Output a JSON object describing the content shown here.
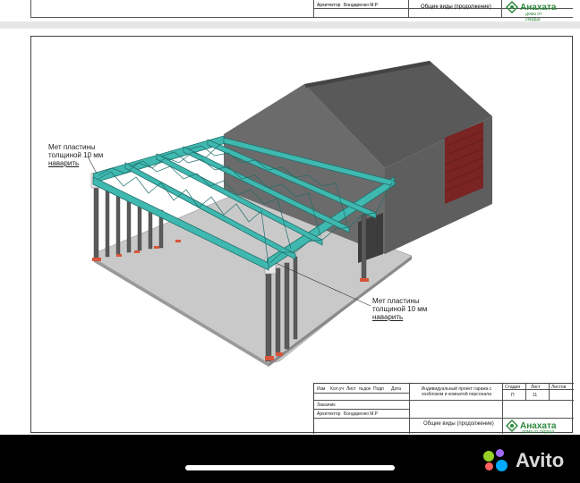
{
  "top_sheet": {
    "architect_label": "Архитектор",
    "architect_name": "Бондаренко М.Р",
    "sheet_title": "Общие виды (продолжение)",
    "brand": "Анахата",
    "brand_tagline": "дома от сердца"
  },
  "annotations": {
    "left": [
      "Мет пластины",
      "толщиной 10 мм",
      "наварить"
    ],
    "right": [
      "Мет пластины",
      "толщиной 10 мм",
      "наварить"
    ]
  },
  "title_block": {
    "header_cells": [
      "Изм",
      "Кол.уч",
      "Лист",
      "№док",
      "Подп",
      "Дата"
    ],
    "project_title": "Индивидуальный проект гаража с хозблоком и комнатой персонала",
    "stage_label": "Стадия",
    "sheet_label": "Лист",
    "sheets_label": "Листов",
    "stage_value": "П",
    "sheet_value": "11",
    "customer_label": "Заказчик",
    "architect_label": "Архитектор",
    "architect_name": "Бондаренко М.Р",
    "sheet_title": "Общие виды (продолжение)",
    "brand": "Анахата",
    "brand_tagline": "дома от сердца"
  },
  "watermark": {
    "text": "Avito"
  },
  "colors": {
    "truss": "#3fb8b0",
    "truss_dark": "#1f6f6a",
    "building_gray": "#6a6a6a",
    "roof_gray": "#555555",
    "door_red": "#7a2424",
    "plate_red": "#d9553a",
    "slab": "#c8c8c8",
    "brand_green": "#2f8a3e"
  }
}
